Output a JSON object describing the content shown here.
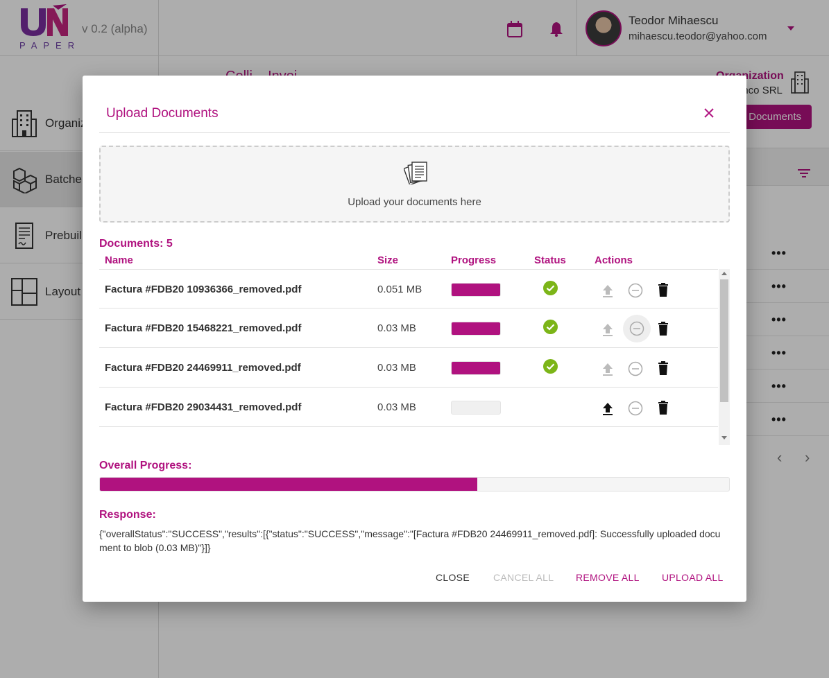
{
  "app": {
    "logo_text": "PAPER",
    "version": "v 0.2 (alpha)"
  },
  "user": {
    "name": "Teodor Mihaescu",
    "email": "mihaescu.teodor@yahoo.com"
  },
  "sidebar": {
    "items": [
      {
        "label": "Organiz",
        "icon": "building-icon",
        "active": false
      },
      {
        "label": "Batche",
        "icon": "boxes-icon",
        "active": true
      },
      {
        "label": "Prebuil",
        "icon": "document-icon",
        "active": false
      },
      {
        "label": "Layout",
        "icon": "layout-icon",
        "active": false
      }
    ]
  },
  "main": {
    "title": "Colli... Invoi...",
    "organization_label": "Organization",
    "organization_name": "anco SRL",
    "upload_button_label": "Documents"
  },
  "modal": {
    "title": "Upload Documents",
    "dropzone_text": "Upload your documents here",
    "documents_count_label": "Documents: 5",
    "columns": [
      "Name",
      "Size",
      "Progress",
      "Status",
      "Actions"
    ],
    "rows": [
      {
        "name": "Factura #FDB20 10936366_removed.pdf",
        "size": "0.051 MB",
        "progress": 1.0,
        "status": "success"
      },
      {
        "name": "Factura #FDB20 15468221_removed.pdf",
        "size": "0.03 MB",
        "progress": 1.0,
        "status": "success"
      },
      {
        "name": "Factura #FDB20 24469911_removed.pdf",
        "size": "0.03 MB",
        "progress": 1.0,
        "status": "success"
      },
      {
        "name": "Factura #FDB20 29034431_removed.pdf",
        "size": "0.03 MB",
        "progress": 0.0,
        "status": "pending"
      }
    ],
    "overall_progress_label": "Overall Progress:",
    "overall_progress": 0.6,
    "response_label": "Response:",
    "response_text": "{\"overallStatus\":\"SUCCESS\",\"results\":[{\"status\":\"SUCCESS\",\"message\":\"[Factura #FDB20 24469911_removed.pdf]: Successfully uploaded document to blob (0.03 MB)\"}]}",
    "buttons": {
      "close": "CLOSE",
      "cancel_all": "CANCEL ALL",
      "remove_all": "REMOVE ALL",
      "upload_all": "UPLOAD ALL"
    }
  },
  "colors": {
    "accent": "#b0127f",
    "success": "#7cb518",
    "overlay": "rgba(0,0,0,0.32)"
  }
}
